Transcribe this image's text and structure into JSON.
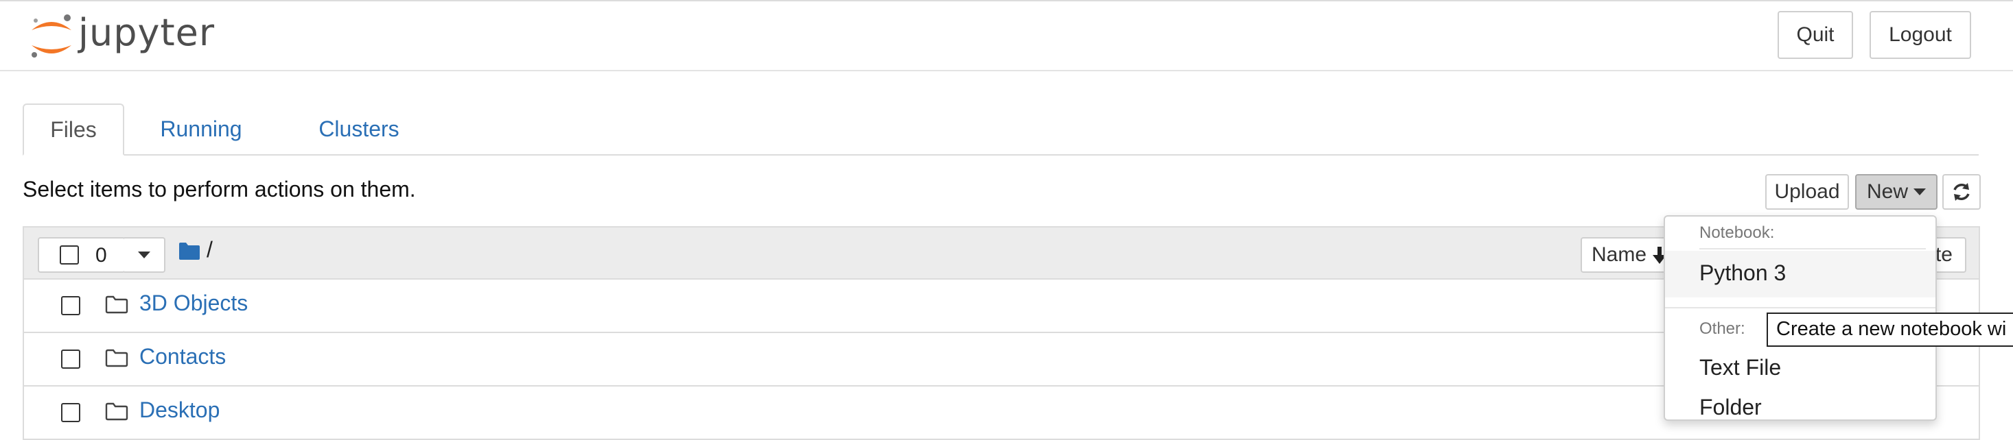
{
  "header": {
    "logo_text": "jupyter",
    "quit_label": "Quit",
    "logout_label": "Logout"
  },
  "tabs": [
    {
      "label": "Files"
    },
    {
      "label": "Running"
    },
    {
      "label": "Clusters"
    }
  ],
  "toolbar": {
    "hint": "Select items to perform actions on them.",
    "upload_label": "Upload",
    "new_label": "New"
  },
  "list_header": {
    "selected_count": "0",
    "breadcrumb_sep": "/",
    "name_sort_label": "Name",
    "last_col_fragment": "te"
  },
  "files": [
    {
      "name": "3D Objects"
    },
    {
      "name": "Contacts"
    },
    {
      "name": "Desktop"
    }
  ],
  "new_menu": {
    "notebook_header": "Notebook:",
    "python3": "Python 3",
    "other_header": "Other:",
    "text_file": "Text File",
    "folder": "Folder"
  },
  "tooltip": "Create a new notebook wi",
  "colors": {
    "link": "#2a6fb5",
    "logo_orange": "#f37626",
    "folder_blue": "#2a6fb5"
  }
}
